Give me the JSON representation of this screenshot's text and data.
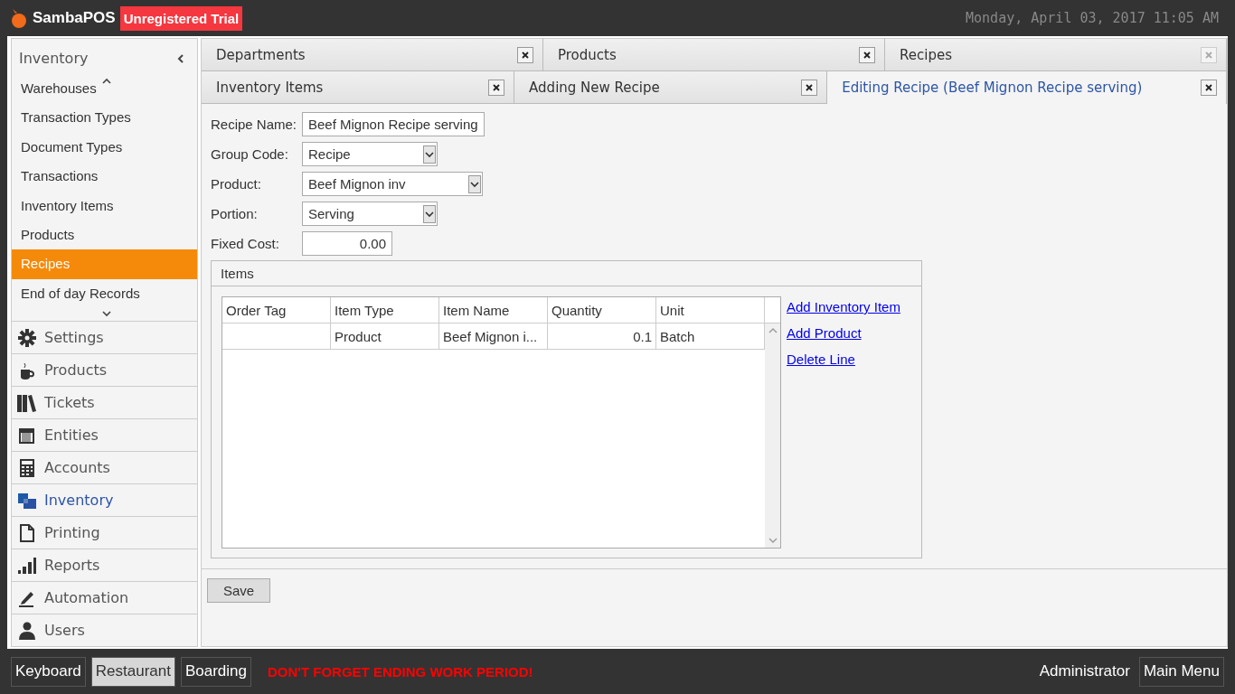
{
  "header": {
    "app_name": "SambaPOS",
    "badge": "Unregistered Trial",
    "datetime": "Monday, April 03, 2017 11:05 AM"
  },
  "sidebar": {
    "title": "Inventory",
    "items": [
      {
        "label": "Warehouses",
        "selected": false
      },
      {
        "label": "Transaction Types",
        "selected": false
      },
      {
        "label": "Document Types",
        "selected": false
      },
      {
        "label": "Transactions",
        "selected": false
      },
      {
        "label": "Inventory Items",
        "selected": false
      },
      {
        "label": "Products",
        "selected": false
      },
      {
        "label": "Recipes",
        "selected": true
      },
      {
        "label": "End of day Records",
        "selected": false
      }
    ],
    "modules": [
      {
        "label": "Settings",
        "kind": "gear",
        "selected": false
      },
      {
        "label": "Products",
        "kind": "cup",
        "selected": false
      },
      {
        "label": "Tickets",
        "kind": "books",
        "selected": false
      },
      {
        "label": "Entities",
        "kind": "grid",
        "selected": false
      },
      {
        "label": "Accounts",
        "kind": "calculator",
        "selected": false
      },
      {
        "label": "Inventory",
        "kind": "squares",
        "selected": true
      },
      {
        "label": "Printing",
        "kind": "page",
        "selected": false
      },
      {
        "label": "Reports",
        "kind": "bars",
        "selected": false
      },
      {
        "label": "Automation",
        "kind": "pen",
        "selected": false
      },
      {
        "label": "Users",
        "kind": "user",
        "selected": false
      }
    ]
  },
  "tab_rows": [
    [
      {
        "label": "Departments",
        "selected": false,
        "close_enabled": true
      },
      {
        "label": "Products",
        "selected": false,
        "close_enabled": true
      },
      {
        "label": "Recipes",
        "selected": false,
        "close_enabled": false
      }
    ],
    [
      {
        "label": "Inventory Items",
        "selected": false,
        "close_enabled": true
      },
      {
        "label": "Adding New Recipe",
        "selected": false,
        "close_enabled": true
      },
      {
        "label": "Editing Recipe (Beef Mignon Recipe serving)",
        "selected": true,
        "close_enabled": true
      }
    ]
  ],
  "form": {
    "fields": [
      {
        "label": "Recipe Name:",
        "kind": "text",
        "value": "Beef Mignon Recipe serving"
      },
      {
        "label": "Group Code:",
        "kind": "dropdown",
        "value": "Recipe"
      },
      {
        "label": "Product:",
        "kind": "dropdown",
        "value": "Beef Mignon inv",
        "wide": true
      },
      {
        "label": "Portion:",
        "kind": "dropdown",
        "value": "Serving"
      },
      {
        "label": "Fixed Cost:",
        "kind": "number",
        "value": "0.00"
      }
    ],
    "items_group": {
      "title": "Items",
      "columns": [
        "Order Tag",
        "Item Type",
        "Item Name",
        "Quantity",
        "Unit"
      ],
      "rows": [
        [
          "",
          "Product",
          "Beef Mignon i...",
          "0.1",
          "Batch"
        ]
      ],
      "links": [
        "Add Inventory Item",
        "Add Product",
        "Delete Line"
      ]
    },
    "save_button": "Save"
  },
  "footer": {
    "buttons": [
      {
        "label": "Keyboard",
        "selected": false
      },
      {
        "label": "Restaurant",
        "selected": true
      },
      {
        "label": "Boarding",
        "selected": false
      }
    ],
    "warning": "DON'T FORGET ENDING WORK PERIOD!",
    "user": "Administrator",
    "main_menu": "Main Menu"
  }
}
